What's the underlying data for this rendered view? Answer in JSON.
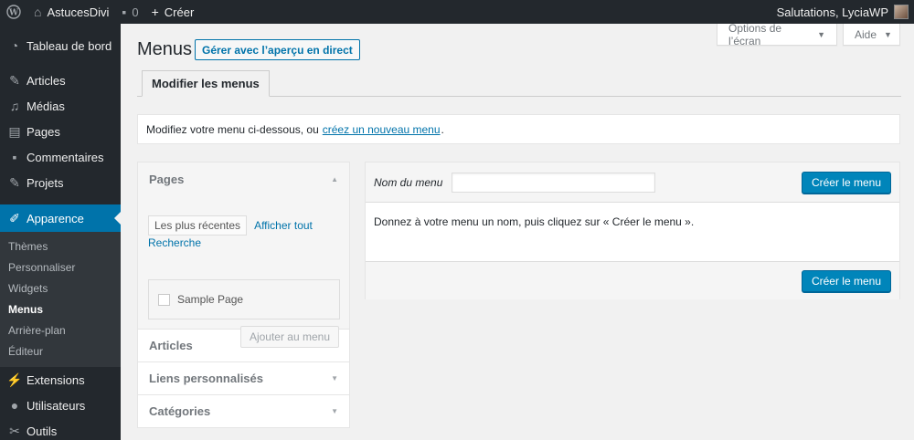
{
  "admin_bar": {
    "site_name": "AstucesDivi",
    "comments_count": "0",
    "new_label": "Créer",
    "greeting": "Salutations, LyciaWP"
  },
  "sidebar": {
    "items_top": [
      {
        "label": "Tableau de bord",
        "icon": "dashboard-icon"
      }
    ],
    "items_mid": [
      {
        "label": "Articles",
        "icon": "pin-icon"
      },
      {
        "label": "Médias",
        "icon": "media-icon"
      },
      {
        "label": "Pages",
        "icon": "page-icon"
      },
      {
        "label": "Commentaires",
        "icon": "comment-icon"
      },
      {
        "label": "Projets",
        "icon": "pin-icon"
      }
    ],
    "current": {
      "label": "Apparence",
      "icon": "brush-icon"
    },
    "submenu": [
      "Thèmes",
      "Personnaliser",
      "Widgets",
      "Menus",
      "Arrière-plan",
      "Éditeur"
    ],
    "items_bottom": [
      {
        "label": "Extensions",
        "icon": "plugin-icon"
      },
      {
        "label": "Utilisateurs",
        "icon": "user-icon"
      },
      {
        "label": "Outils",
        "icon": "wrench-icon"
      }
    ]
  },
  "screen_meta": {
    "options_label": "Options de l’écran",
    "help_label": "Aide"
  },
  "page": {
    "title": "Menus",
    "title_action": "Gérer avec l’aperçu en direct",
    "tab": "Modifier les menus",
    "notice_text": "Modifiez votre menu ci-dessous, ou",
    "notice_link": "créez un nouveau menu",
    "notice_end": "."
  },
  "accordion": {
    "sections": [
      "Pages",
      "Articles",
      "Liens personnalisés",
      "Catégories"
    ],
    "pages": {
      "tab_recent": "Les plus récentes",
      "tab_all": "Afficher tout",
      "tab_search": "Recherche",
      "items": [
        "Sample Page"
      ],
      "add_button": "Ajouter au menu"
    }
  },
  "editor": {
    "name_label": "Nom du menu",
    "name_value": "",
    "create_button": "Créer le menu",
    "instructions": "Donnez à votre menu un nom, puis cliquez sur « Créer le menu »."
  },
  "colors": {
    "admin_dark": "#23282d",
    "accent": "#0073aa",
    "primary_button": "#0085ba"
  }
}
